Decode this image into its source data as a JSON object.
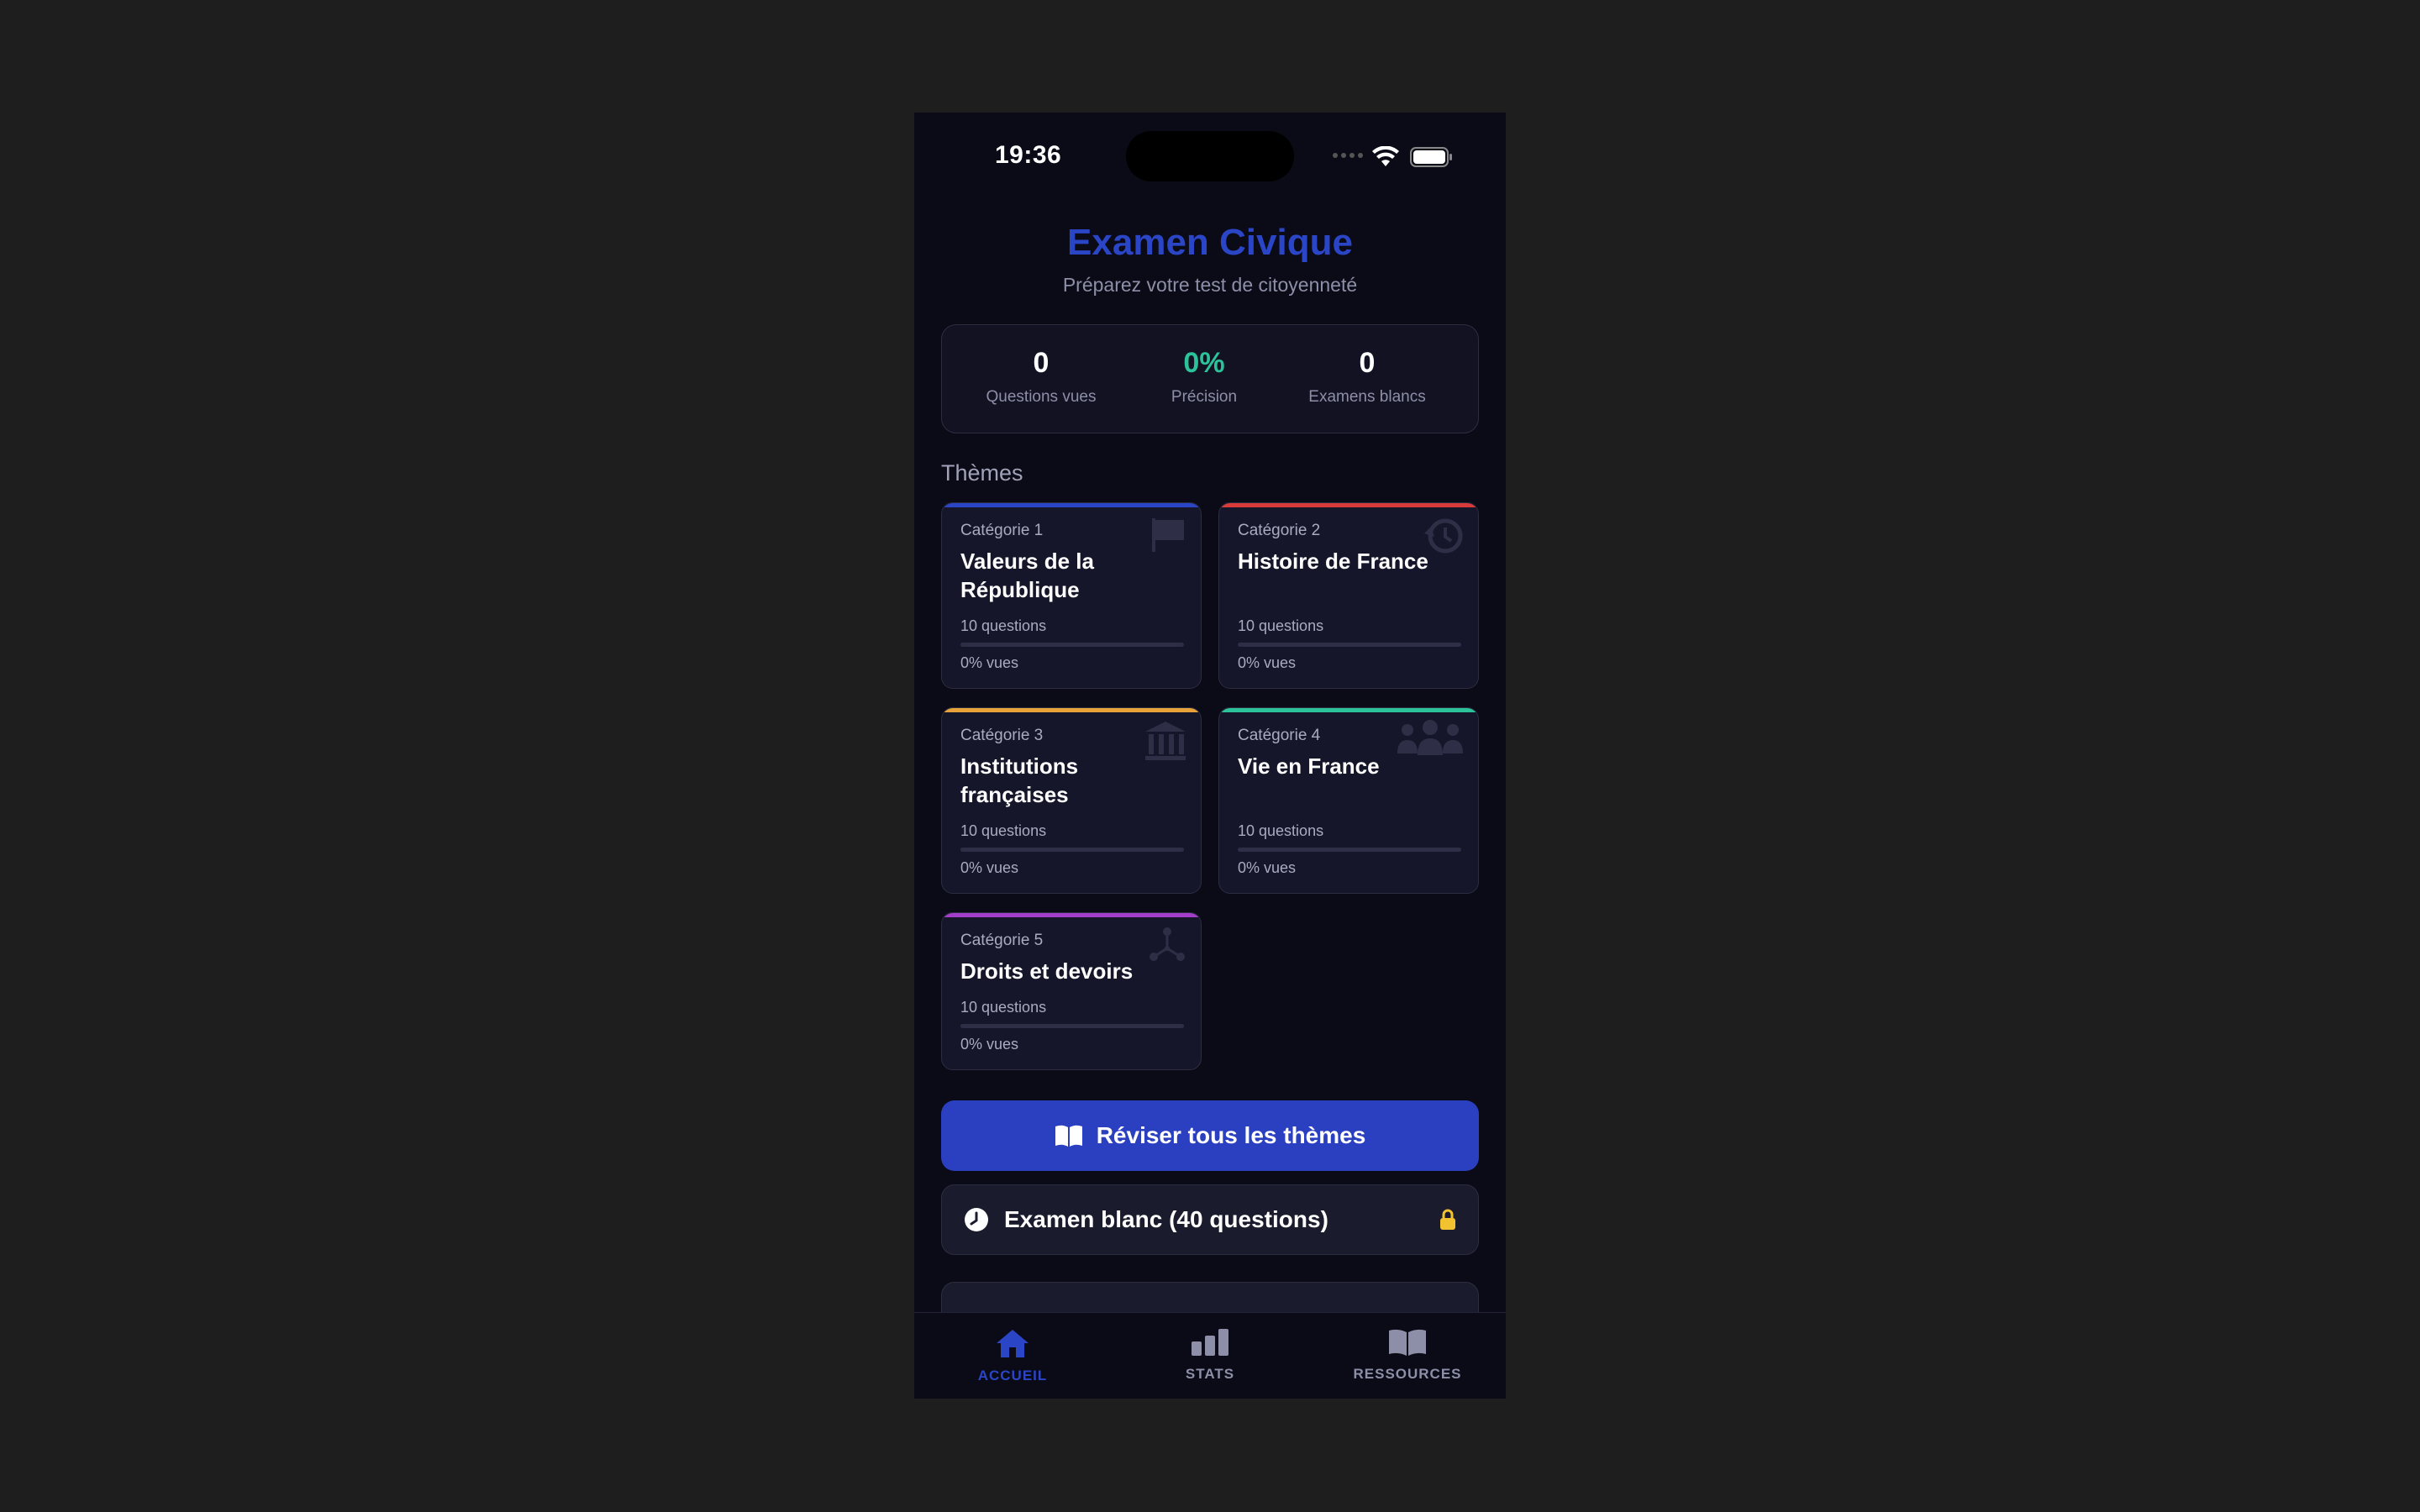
{
  "status_bar": {
    "time": "19:36"
  },
  "header": {
    "title": "Examen Civique",
    "subtitle": "Préparez votre test de citoyenneté"
  },
  "stats": [
    {
      "value": "0",
      "label": "Questions vues"
    },
    {
      "value": "0%",
      "label": "Précision"
    },
    {
      "value": "0",
      "label": "Examens blancs"
    }
  ],
  "themes": {
    "title": "Thèmes",
    "categories": [
      {
        "label": "Catégorie 1",
        "name": "Valeurs de la République",
        "questions": "10 questions",
        "progress": 0,
        "seen": "0% vues",
        "color": "#2b45c7",
        "icon": "flag-icon"
      },
      {
        "label": "Catégorie 2",
        "name": "Histoire de France",
        "questions": "10 questions",
        "progress": 0,
        "seen": "0% vues",
        "color": "#d93a3a",
        "icon": "history-icon"
      },
      {
        "label": "Catégorie 3",
        "name": "Institutions françaises",
        "questions": "10 questions",
        "progress": 0,
        "seen": "0% vues",
        "color": "#e8a23a",
        "icon": "institution-icon"
      },
      {
        "label": "Catégorie 4",
        "name": "Vie en France",
        "questions": "10 questions",
        "progress": 0,
        "seen": "0% vues",
        "color": "#2cc39b",
        "icon": "people-icon"
      },
      {
        "label": "Catégorie 5",
        "name": "Droits et devoirs",
        "questions": "10 questions",
        "progress": 0,
        "seen": "0% vues",
        "color": "#a23ec9",
        "icon": "network-icon"
      }
    ]
  },
  "actions": {
    "review_all": "Réviser tous les thèmes",
    "mock_exam": "Examen blanc (40 questions)"
  },
  "tabbar": [
    {
      "label": "ACCUEIL",
      "icon": "home-icon",
      "active": true
    },
    {
      "label": "STATS",
      "icon": "bar-chart-icon",
      "active": false
    },
    {
      "label": "RESSOURCES",
      "icon": "book-icon",
      "active": false
    }
  ],
  "colors": {
    "accent": "#2b45c7",
    "success": "#2cc39b",
    "warning": "#f2c230",
    "background": "#0b0b17"
  }
}
